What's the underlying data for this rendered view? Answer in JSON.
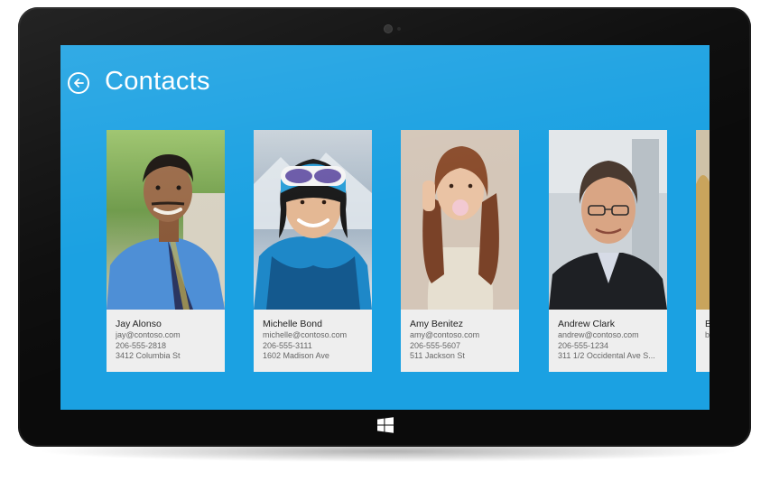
{
  "app": {
    "title": "Contacts"
  },
  "contacts": [
    {
      "name": "Jay Alonso",
      "email": "jay@contoso.com",
      "phone": "206-555-2818",
      "address": "3412 Columbia St"
    },
    {
      "name": "Michelle Bond",
      "email": "michelle@contoso.com",
      "phone": "206-555-3111",
      "address": "1602 Madison Ave"
    },
    {
      "name": "Amy Benitez",
      "email": "amy@contoso.com",
      "phone": "206-555-5607",
      "address": "511 Jackson St"
    },
    {
      "name": "Andrew Clark",
      "email": "andrew@contoso.com",
      "phone": "206-555-1234",
      "address": "311 1/2 Occidental Ave S..."
    },
    {
      "name": "B",
      "email": "b",
      "phone": "",
      "address": ""
    }
  ],
  "colors": {
    "accent": "#1ba1e2",
    "card": "#eeeeee",
    "bezel": "#0b0b0b"
  },
  "icons": {
    "back": "back-arrow-circle-icon",
    "start": "windows-logo-icon"
  }
}
